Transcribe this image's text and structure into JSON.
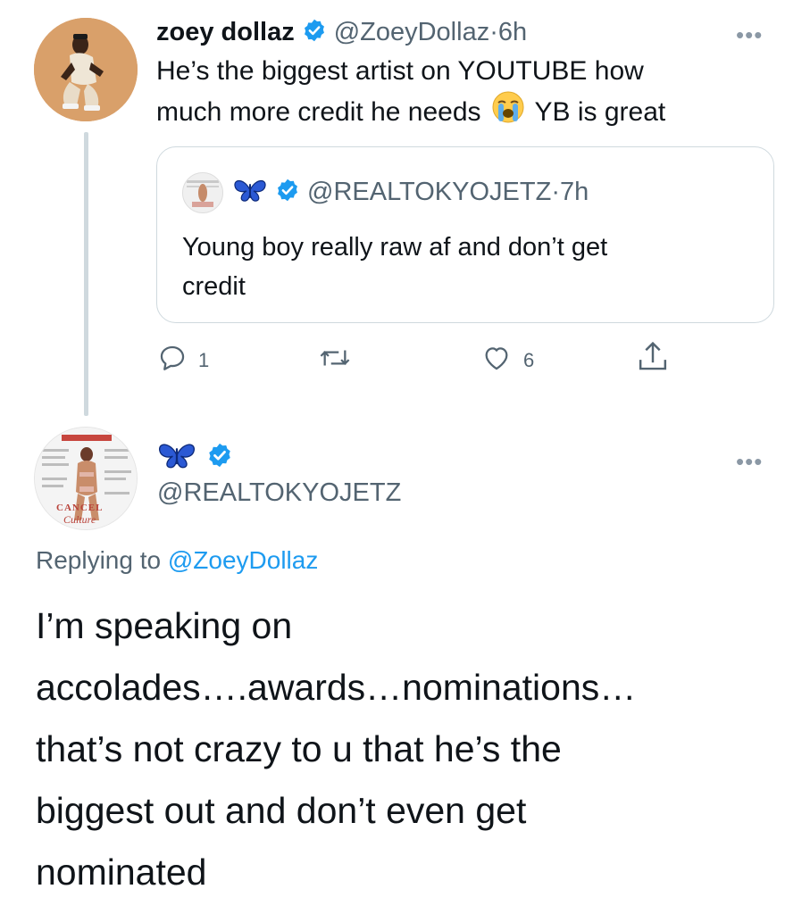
{
  "colors": {
    "verified_blue": "#1d9bf0",
    "link_blue": "#1d9bf0",
    "secondary_text": "#536471",
    "border": "#cfd9de",
    "butterfly_blue": "#2b59d4"
  },
  "tweet": {
    "author_name": "zoey dollaz",
    "handle": "@ZoeyDollaz",
    "separator": " · ",
    "time": "6h",
    "text_line1": "He’s the biggest artist on YOUTUBE how",
    "text_line2a": "much more credit he needs",
    "emoji": "😭",
    "text_line2b": "YB is great",
    "more_label": "•••",
    "icons": [
      "avatar",
      "verified-badge-icon",
      "more-options-icon"
    ]
  },
  "quoted_tweet": {
    "author_name_emoji": "butterfly",
    "handle": "@REALTOKYOJETZ",
    "separator": " · ",
    "time": "7h",
    "text_line1": "Young boy really raw af and don’t get",
    "text_line2": "credit"
  },
  "actions": {
    "reply_count": "1",
    "retweet_count": "",
    "like_count": "6",
    "icons": [
      "reply-icon",
      "retweet-icon",
      "like-icon",
      "share-icon"
    ]
  },
  "reply": {
    "author_name_emoji": "butterfly",
    "handle": "@REALTOKYOJETZ",
    "more_label": "•••",
    "replying_to_prefix": "Replying to ",
    "replying_to_handle": "@ZoeyDollaz",
    "text_lines": [
      "I’m speaking on",
      "accolades….awards…nominations…",
      "that’s not crazy to u that he’s the",
      "biggest out and don’t even get",
      "nominated"
    ],
    "avatar_caption_line1": "CANCEL",
    "avatar_caption_line2": "Culture"
  }
}
